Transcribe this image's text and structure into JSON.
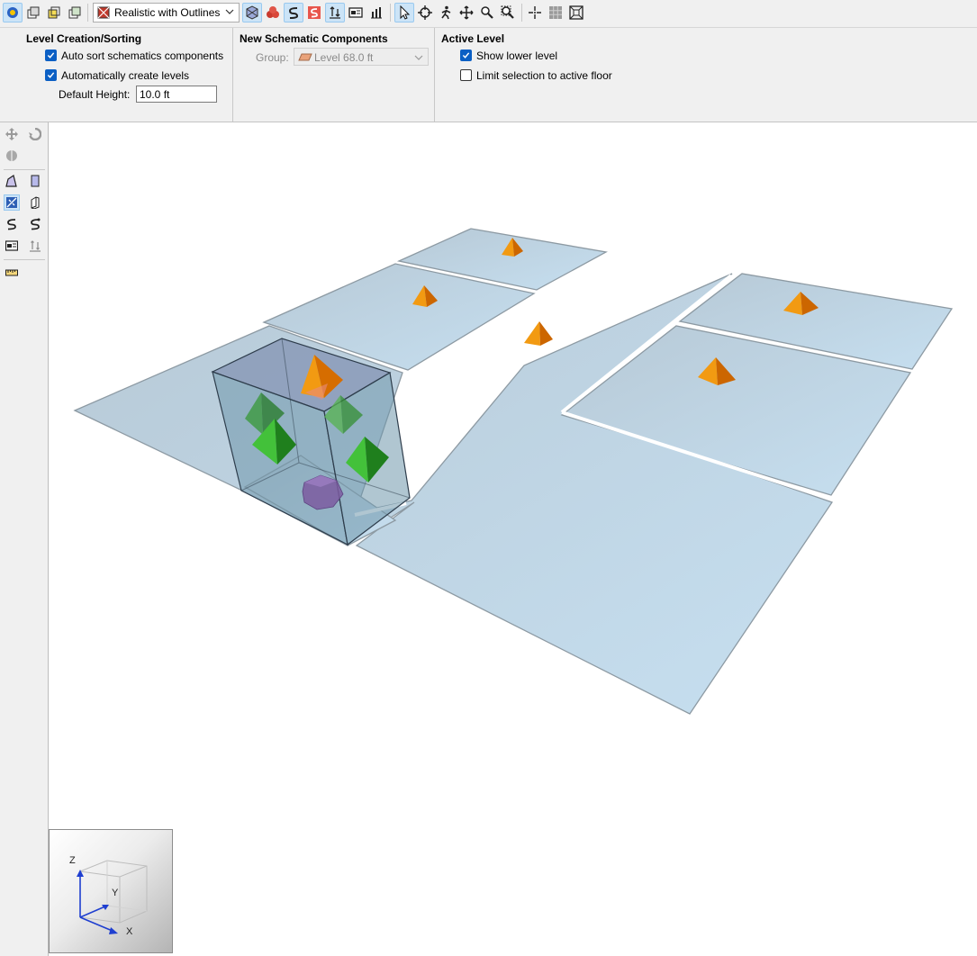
{
  "toolbar": {
    "render_mode": "Realistic with Outlines",
    "icons": [
      "view-home-icon",
      "view-front-icon",
      "view-side-icon",
      "view-top-icon",
      "render-style-icon",
      "x-ray-icon",
      "component-cluster-icon",
      "pipe-route-icon",
      "pipe-route-red-icon",
      "level-sort-icon",
      "schematic-card-icon",
      "bar-chart-icon",
      "select-arrow-icon",
      "orbit-icon",
      "walk-icon",
      "pan-icon",
      "zoom-icon",
      "zoom-window-icon",
      "center-view-icon",
      "grid-icon",
      "fit-view-icon"
    ]
  },
  "level_creation": {
    "title": "Level Creation/Sorting",
    "auto_sort": {
      "label": "Auto sort schematics components",
      "checked": true
    },
    "auto_create": {
      "label": "Automatically create levels",
      "checked": true
    },
    "default_height_label": "Default Height:",
    "default_height_value": "10.0 ft"
  },
  "new_components": {
    "title": "New Schematic Components",
    "group_label": "Group:",
    "group_value": "Level 68.0 ft"
  },
  "active_level": {
    "title": "Active Level",
    "show_lower": {
      "label": "Show lower level",
      "checked": true
    },
    "limit_selection": {
      "label": "Limit selection to active floor",
      "checked": false
    }
  },
  "palette": {
    "icons": [
      "move-icon",
      "rotate-icon",
      "mirror-icon",
      "draw-room-icon",
      "draw-box-icon",
      "slab-icon",
      "wall-icon",
      "duct-route-icon",
      "pipe-link-icon",
      "schematic-card-icon",
      "level-sort-icon",
      "measure-icon"
    ]
  },
  "axis_indicator": {
    "z": "Z",
    "y": "Y",
    "x": "X"
  },
  "colors": {
    "floor": "#bfd4e2",
    "selection_box": "#7f9fb4",
    "terminal_orange": "#f28c00",
    "diffuser_green": "#2fa62a",
    "unit_purple": "#7b5aa0",
    "axis_blue": "#1f3fd0"
  }
}
